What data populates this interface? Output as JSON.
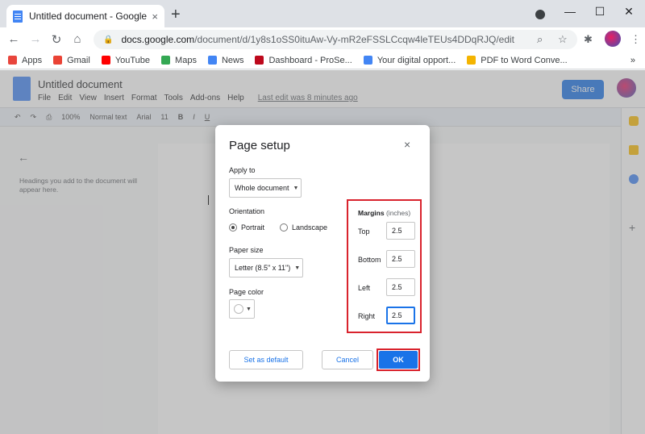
{
  "browser": {
    "tab_title": "Untitled document - Google Doc",
    "tab_close": "×",
    "new_tab": "+",
    "url_host": "docs.google.com",
    "url_path": "/document/d/1y8s1oSS0ituAw-Vy-mR2eFSSLCcqw4leTEUs4DDqRJQ/edit",
    "minimize": "—",
    "maximize": "☐",
    "close": "✕"
  },
  "bookmarks": [
    {
      "label": "Apps",
      "color": "#e8453c"
    },
    {
      "label": "Gmail",
      "color": "#ea4335"
    },
    {
      "label": "YouTube",
      "color": "#ff0000"
    },
    {
      "label": "Maps",
      "color": "#34a853"
    },
    {
      "label": "News",
      "color": "#4285f4"
    },
    {
      "label": "Dashboard - ProSe...",
      "color": "#bd081c"
    },
    {
      "label": "Your digital opport...",
      "color": "#4285f4"
    },
    {
      "label": "PDF to Word Conve...",
      "color": "#f4b400"
    }
  ],
  "bookmarks_more": "»",
  "docs": {
    "title": "Untitled document",
    "menu": [
      "File",
      "Edit",
      "View",
      "Insert",
      "Format",
      "Tools",
      "Add-ons",
      "Help"
    ],
    "last_edit": "Last edit was 8 minutes ago",
    "share": "Share",
    "toolbar": {
      "zoom": "100%",
      "style": "Normal text",
      "font": "Arial",
      "size": "11"
    },
    "outline_text": "Headings you add to the document will appear here."
  },
  "dialog": {
    "title": "Page setup",
    "close": "×",
    "apply_to_label": "Apply to",
    "apply_to_value": "Whole document",
    "orientation_label": "Orientation",
    "portrait": "Portrait",
    "landscape": "Landscape",
    "paper_size_label": "Paper size",
    "paper_size_value": "Letter (8.5\" x 11\")",
    "page_color_label": "Page color",
    "margins_label": "Margins",
    "margins_unit": "(inches)",
    "margins": {
      "top_label": "Top",
      "top": "2.5",
      "bottom_label": "Bottom",
      "bottom": "2.5",
      "left_label": "Left",
      "left": "2.5",
      "right_label": "Right",
      "right": "2.5"
    },
    "set_default": "Set as default",
    "cancel": "Cancel",
    "ok": "OK"
  },
  "colors": {
    "accent": "#1a73e8",
    "highlight": "#d9232d"
  }
}
